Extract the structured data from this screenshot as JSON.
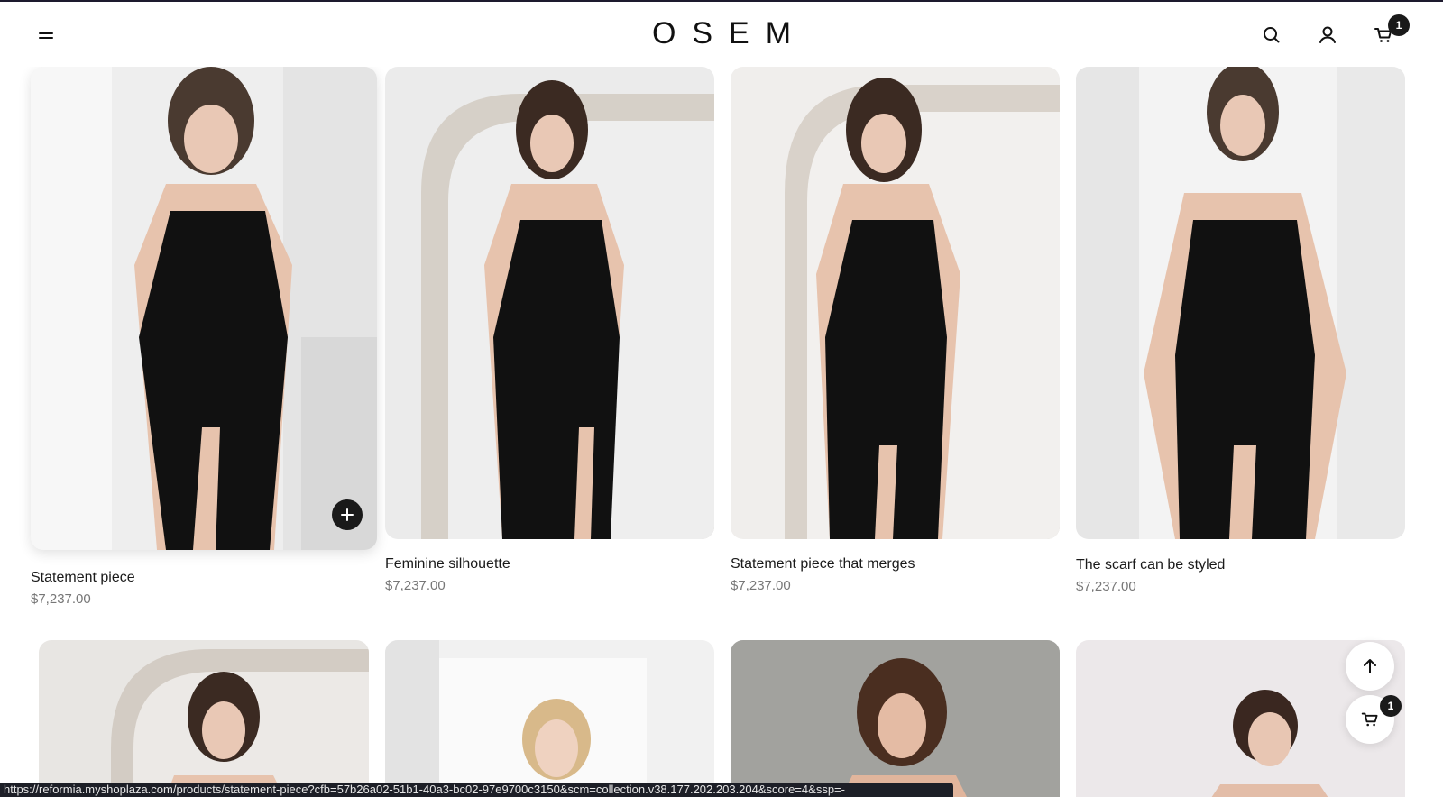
{
  "header": {
    "logo": "OSEM",
    "cart_count": "1"
  },
  "products_row1": [
    {
      "title": "Statement piece",
      "price": "$7,237.00"
    },
    {
      "title": "Feminine silhouette",
      "price": "$7,237.00"
    },
    {
      "title": "Statement piece that merges",
      "price": "$7,237.00"
    },
    {
      "title": "The scarf can be styled",
      "price": "$7,237.00"
    }
  ],
  "floating": {
    "cart_count": "1"
  },
  "statusbar": {
    "url": "https://reformia.myshoplaza.com/products/statement-piece?cfb=57b26a02-51b1-40a3-bc02-97e9700c3150&scm=collection.v38.177.202.203.204&score=4&ssp=-"
  },
  "colors": {
    "accent": "#1a1a1a",
    "price": "#777777",
    "statusbar_bg": "#1d1f27"
  }
}
